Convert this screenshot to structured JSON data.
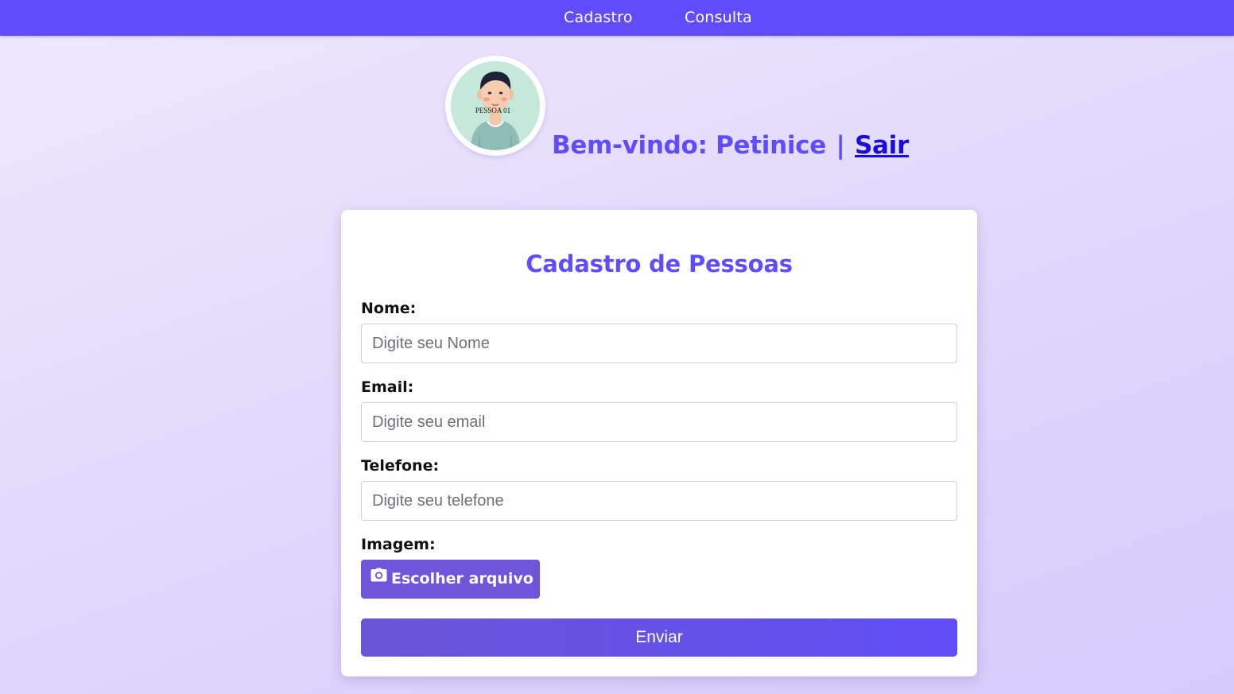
{
  "nav": {
    "items": [
      {
        "label": "Cadastro"
      },
      {
        "label": "Consulta"
      }
    ]
  },
  "header": {
    "avatar_caption": "PESSOA 01",
    "welcome_text": "Bem-vindo: Petinice",
    "separator": "|",
    "logout_label": "Sair"
  },
  "form": {
    "title": "Cadastro de Pessoas",
    "fields": [
      {
        "label": "Nome:",
        "placeholder": "Digite seu Nome",
        "value": ""
      },
      {
        "label": "Email:",
        "placeholder": "Digite seu email",
        "value": ""
      },
      {
        "label": "Telefone:",
        "placeholder": "Digite seu telefone",
        "value": ""
      }
    ],
    "image": {
      "label": "Imagem:",
      "button_label": "Escolher arquivo",
      "icon": "camera-icon"
    },
    "submit_label": "Enviar"
  },
  "colors": {
    "accent": "#5f4dfb",
    "file_button": "#6f55d8",
    "link": "#1a0ddb",
    "avatar_bg": "#c5e8da"
  }
}
